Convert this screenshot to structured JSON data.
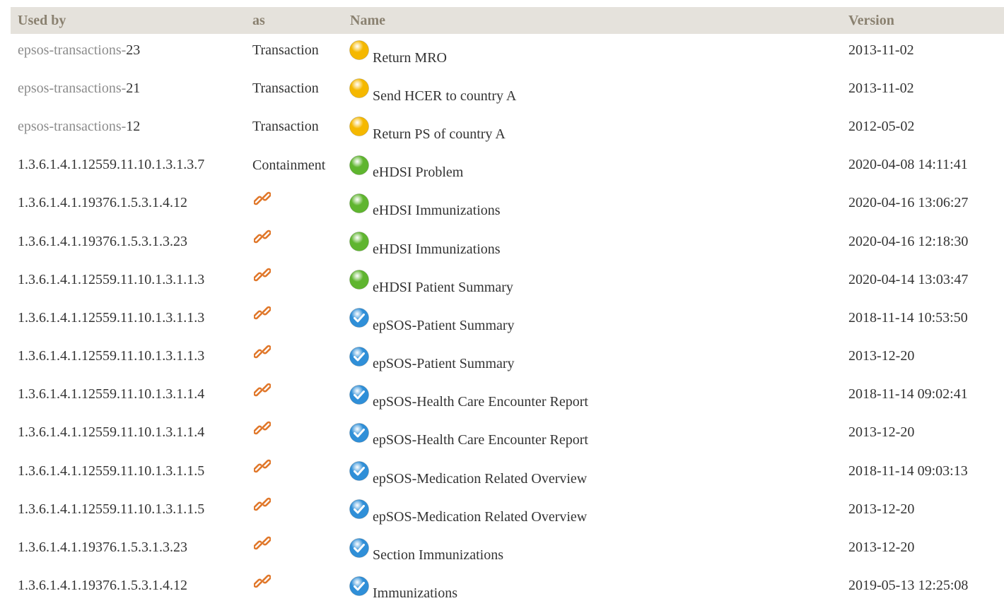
{
  "columns": {
    "used_by": "Used by",
    "as": "as",
    "name": "Name",
    "version": "Version"
  },
  "colors": {
    "header_bg": "#e5e2dc",
    "header_text": "#8a8170",
    "status_pending": "#f5b800",
    "status_active": "#5fb52f",
    "status_final": "#2f8fd8",
    "link_icon": "#e0772a"
  },
  "rows": [
    {
      "used_by_prefix": "epsos-transactions-",
      "used_by_id": "23",
      "as": "Transaction",
      "as_type": "text",
      "status": "pending",
      "name": "Return MRO",
      "version": "2013-11-02"
    },
    {
      "used_by_prefix": "epsos-transactions-",
      "used_by_id": "21",
      "as": "Transaction",
      "as_type": "text",
      "status": "pending",
      "name": "Send HCER to country A",
      "version": "2013-11-02"
    },
    {
      "used_by_prefix": "epsos-transactions-",
      "used_by_id": "12",
      "as": "Transaction",
      "as_type": "text",
      "status": "pending",
      "name": "Return PS of country A",
      "version": "2012-05-02"
    },
    {
      "used_by_prefix": "",
      "used_by_id": "1.3.6.1.4.1.12559.11.10.1.3.1.3.7",
      "as": "Containment",
      "as_type": "text",
      "status": "active",
      "name": "eHDSI Problem",
      "version": "2020-04-08 14:11:41"
    },
    {
      "used_by_prefix": "",
      "used_by_id": "1.3.6.1.4.1.19376.1.5.3.1.4.12",
      "as": "link-icon",
      "as_type": "icon",
      "status": "active",
      "name": "eHDSI Immunizations",
      "version": "2020-04-16 13:06:27"
    },
    {
      "used_by_prefix": "",
      "used_by_id": "1.3.6.1.4.1.19376.1.5.3.1.3.23",
      "as": "link-icon",
      "as_type": "icon",
      "status": "active",
      "name": "eHDSI Immunizations",
      "version": "2020-04-16 12:18:30"
    },
    {
      "used_by_prefix": "",
      "used_by_id": "1.3.6.1.4.1.12559.11.10.1.3.1.1.3",
      "as": "link-icon",
      "as_type": "icon",
      "status": "active",
      "name": "eHDSI Patient Summary",
      "version": "2020-04-14 13:03:47"
    },
    {
      "used_by_prefix": "",
      "used_by_id": "1.3.6.1.4.1.12559.11.10.1.3.1.1.3",
      "as": "link-icon",
      "as_type": "icon",
      "status": "final",
      "name": "epSOS-Patient Summary",
      "version": "2018-11-14 10:53:50"
    },
    {
      "used_by_prefix": "",
      "used_by_id": "1.3.6.1.4.1.12559.11.10.1.3.1.1.3",
      "as": "link-icon",
      "as_type": "icon",
      "status": "final",
      "name": "epSOS-Patient Summary",
      "version": "2013-12-20"
    },
    {
      "used_by_prefix": "",
      "used_by_id": "1.3.6.1.4.1.12559.11.10.1.3.1.1.4",
      "as": "link-icon",
      "as_type": "icon",
      "status": "final",
      "name": "epSOS-Health Care Encounter Report",
      "version": "2018-11-14 09:02:41"
    },
    {
      "used_by_prefix": "",
      "used_by_id": "1.3.6.1.4.1.12559.11.10.1.3.1.1.4",
      "as": "link-icon",
      "as_type": "icon",
      "status": "final",
      "name": "epSOS-Health Care Encounter Report",
      "version": "2013-12-20"
    },
    {
      "used_by_prefix": "",
      "used_by_id": "1.3.6.1.4.1.12559.11.10.1.3.1.1.5",
      "as": "link-icon",
      "as_type": "icon",
      "status": "final",
      "name": "epSOS-Medication Related Overview",
      "version": "2018-11-14 09:03:13"
    },
    {
      "used_by_prefix": "",
      "used_by_id": "1.3.6.1.4.1.12559.11.10.1.3.1.1.5",
      "as": "link-icon",
      "as_type": "icon",
      "status": "final",
      "name": "epSOS-Medication Related Overview",
      "version": "2013-12-20"
    },
    {
      "used_by_prefix": "",
      "used_by_id": "1.3.6.1.4.1.19376.1.5.3.1.3.23",
      "as": "link-icon",
      "as_type": "icon",
      "status": "final",
      "name": "Section Immunizations",
      "version": "2013-12-20"
    },
    {
      "used_by_prefix": "",
      "used_by_id": "1.3.6.1.4.1.19376.1.5.3.1.4.12",
      "as": "link-icon",
      "as_type": "icon",
      "status": "final",
      "name": "Immunizations",
      "version": "2019-05-13 12:25:08"
    }
  ]
}
